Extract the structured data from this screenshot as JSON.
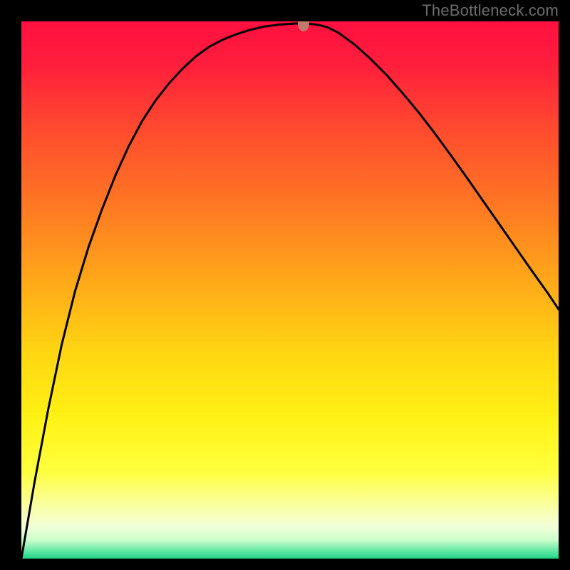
{
  "watermark": "TheBottleneck.com",
  "colors": {
    "frame_bg": "#000000",
    "watermark_text": "#6b6b6b",
    "curve_stroke": "#000000",
    "marker_fill": "#bf7a6b",
    "gradient_stops": [
      {
        "offset": 0.0,
        "color": "#ff1040"
      },
      {
        "offset": 0.08,
        "color": "#ff1e3c"
      },
      {
        "offset": 0.2,
        "color": "#ff4a2e"
      },
      {
        "offset": 0.35,
        "color": "#ff7a22"
      },
      {
        "offset": 0.5,
        "color": "#ffae18"
      },
      {
        "offset": 0.62,
        "color": "#ffd712"
      },
      {
        "offset": 0.74,
        "color": "#fff215"
      },
      {
        "offset": 0.84,
        "color": "#ffff40"
      },
      {
        "offset": 0.9,
        "color": "#faffa0"
      },
      {
        "offset": 0.94,
        "color": "#f2ffd8"
      },
      {
        "offset": 0.965,
        "color": "#ccffcc"
      },
      {
        "offset": 0.985,
        "color": "#66e9a6"
      },
      {
        "offset": 1.0,
        "color": "#1fd184"
      }
    ]
  },
  "chart_data": {
    "type": "line",
    "title": "",
    "xlabel": "",
    "ylabel": "",
    "xlim": [
      0,
      1
    ],
    "ylim": [
      0,
      1
    ],
    "series": [
      {
        "name": "curve",
        "x": [
          0.0,
          0.025,
          0.05,
          0.075,
          0.1,
          0.125,
          0.15,
          0.175,
          0.2,
          0.225,
          0.25,
          0.275,
          0.3,
          0.325,
          0.35,
          0.375,
          0.4,
          0.425,
          0.45,
          0.465,
          0.48,
          0.495,
          0.51,
          0.525,
          0.54,
          0.555,
          0.57,
          0.59,
          0.62,
          0.65,
          0.68,
          0.71,
          0.74,
          0.77,
          0.8,
          0.83,
          0.86,
          0.89,
          0.92,
          0.95,
          0.98,
          1.0
        ],
        "y": [
          0.0,
          0.145,
          0.278,
          0.398,
          0.498,
          0.58,
          0.65,
          0.713,
          0.768,
          0.815,
          0.853,
          0.885,
          0.912,
          0.935,
          0.953,
          0.966,
          0.976,
          0.984,
          0.99,
          0.992,
          0.994,
          0.995,
          0.996,
          0.996,
          0.995,
          0.993,
          0.989,
          0.979,
          0.957,
          0.93,
          0.9,
          0.866,
          0.83,
          0.791,
          0.75,
          0.708,
          0.665,
          0.622,
          0.579,
          0.536,
          0.494,
          0.464
        ]
      }
    ],
    "marker": {
      "x": 0.525,
      "y": 0.996
    },
    "background_gradient": "vertical red→yellow→green (good=bottom)"
  }
}
